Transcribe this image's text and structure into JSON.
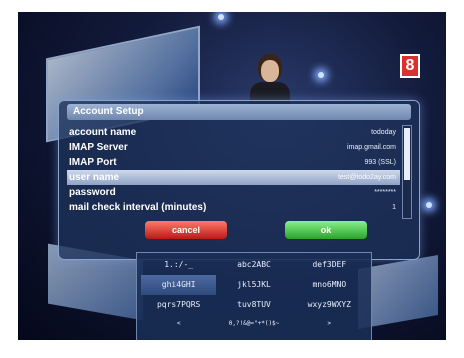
{
  "dialog": {
    "title": "Account Setup",
    "rows": [
      {
        "label": "account name",
        "value": "tododay"
      },
      {
        "label": "IMAP Server",
        "value": "imap.gmail.com"
      },
      {
        "label": "IMAP Port",
        "value": "993 (SSL)"
      },
      {
        "label": "user name",
        "value": "test@todo2ay.com",
        "selected": true
      },
      {
        "label": "password",
        "value": "********"
      },
      {
        "label": "mail check interval (minutes)",
        "value": "1"
      }
    ],
    "cancel_label": "cancel",
    "ok_label": "ok"
  },
  "keyboard": {
    "rows": [
      [
        "1.:/-_",
        "abc2ABC",
        "def3DEF"
      ],
      [
        "ghi4GHI",
        "jkl5JKL",
        "mno6MNO"
      ],
      [
        "pqrs7PQRS",
        "tuv8TUV",
        "wxyz9WXYZ"
      ],
      [
        "<",
        "0,?!&@=\"+*()$~",
        ">"
      ]
    ],
    "selected_key": "ghi4GHI"
  },
  "channel_logo": "8"
}
